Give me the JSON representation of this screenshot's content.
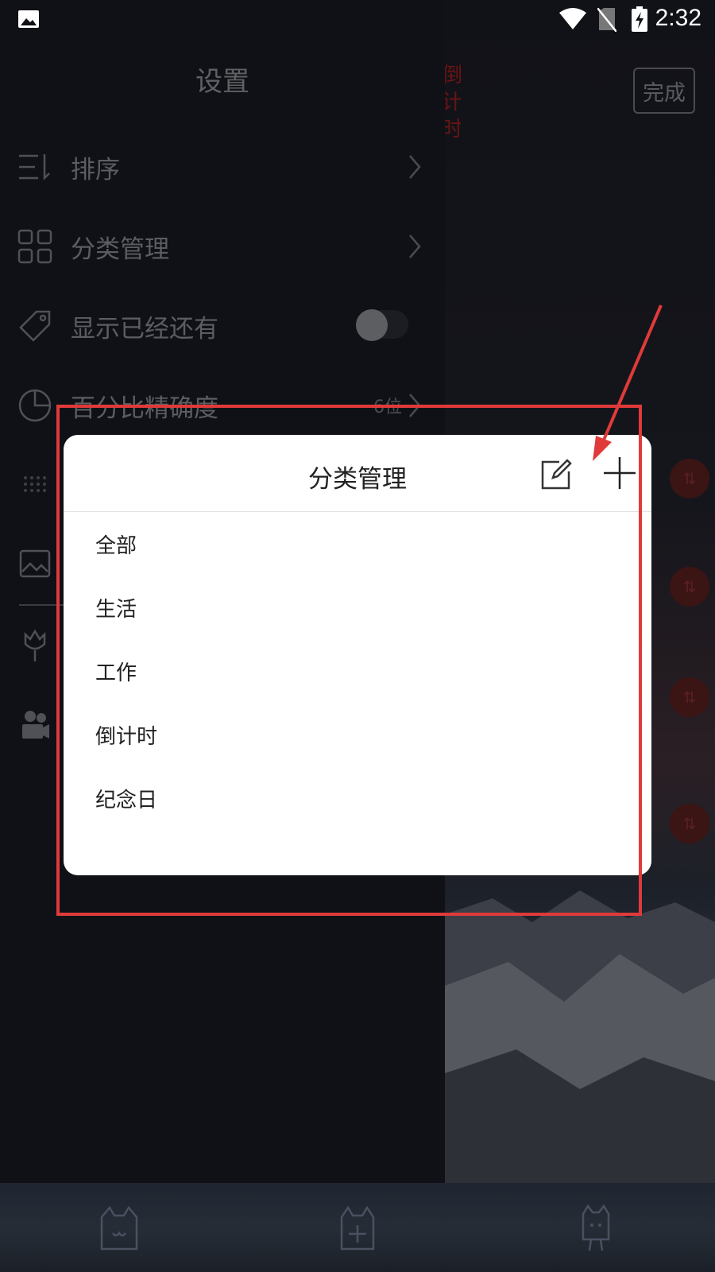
{
  "status_bar": {
    "time": "2:32"
  },
  "drawer": {
    "title": "设置",
    "items": [
      {
        "label": "排序",
        "icon": "sort-icon"
      },
      {
        "label": "分类管理",
        "icon": "grid-icon"
      },
      {
        "label": "显示已经还有",
        "icon": "tag-icon",
        "toggle": false
      },
      {
        "label": "百分比精确度",
        "icon": "pie-chart-icon",
        "value": "6位"
      }
    ]
  },
  "background": {
    "done_label": "完成",
    "top_label": "倒计时"
  },
  "dialog": {
    "title": "分类管理",
    "categories": [
      "全部",
      "生活",
      "工作",
      "倒计时",
      "纪念日"
    ]
  },
  "colors": {
    "accent_red": "#e03a3a",
    "drawer_bg": "#101116",
    "dialog_bg": "#ffffff"
  }
}
